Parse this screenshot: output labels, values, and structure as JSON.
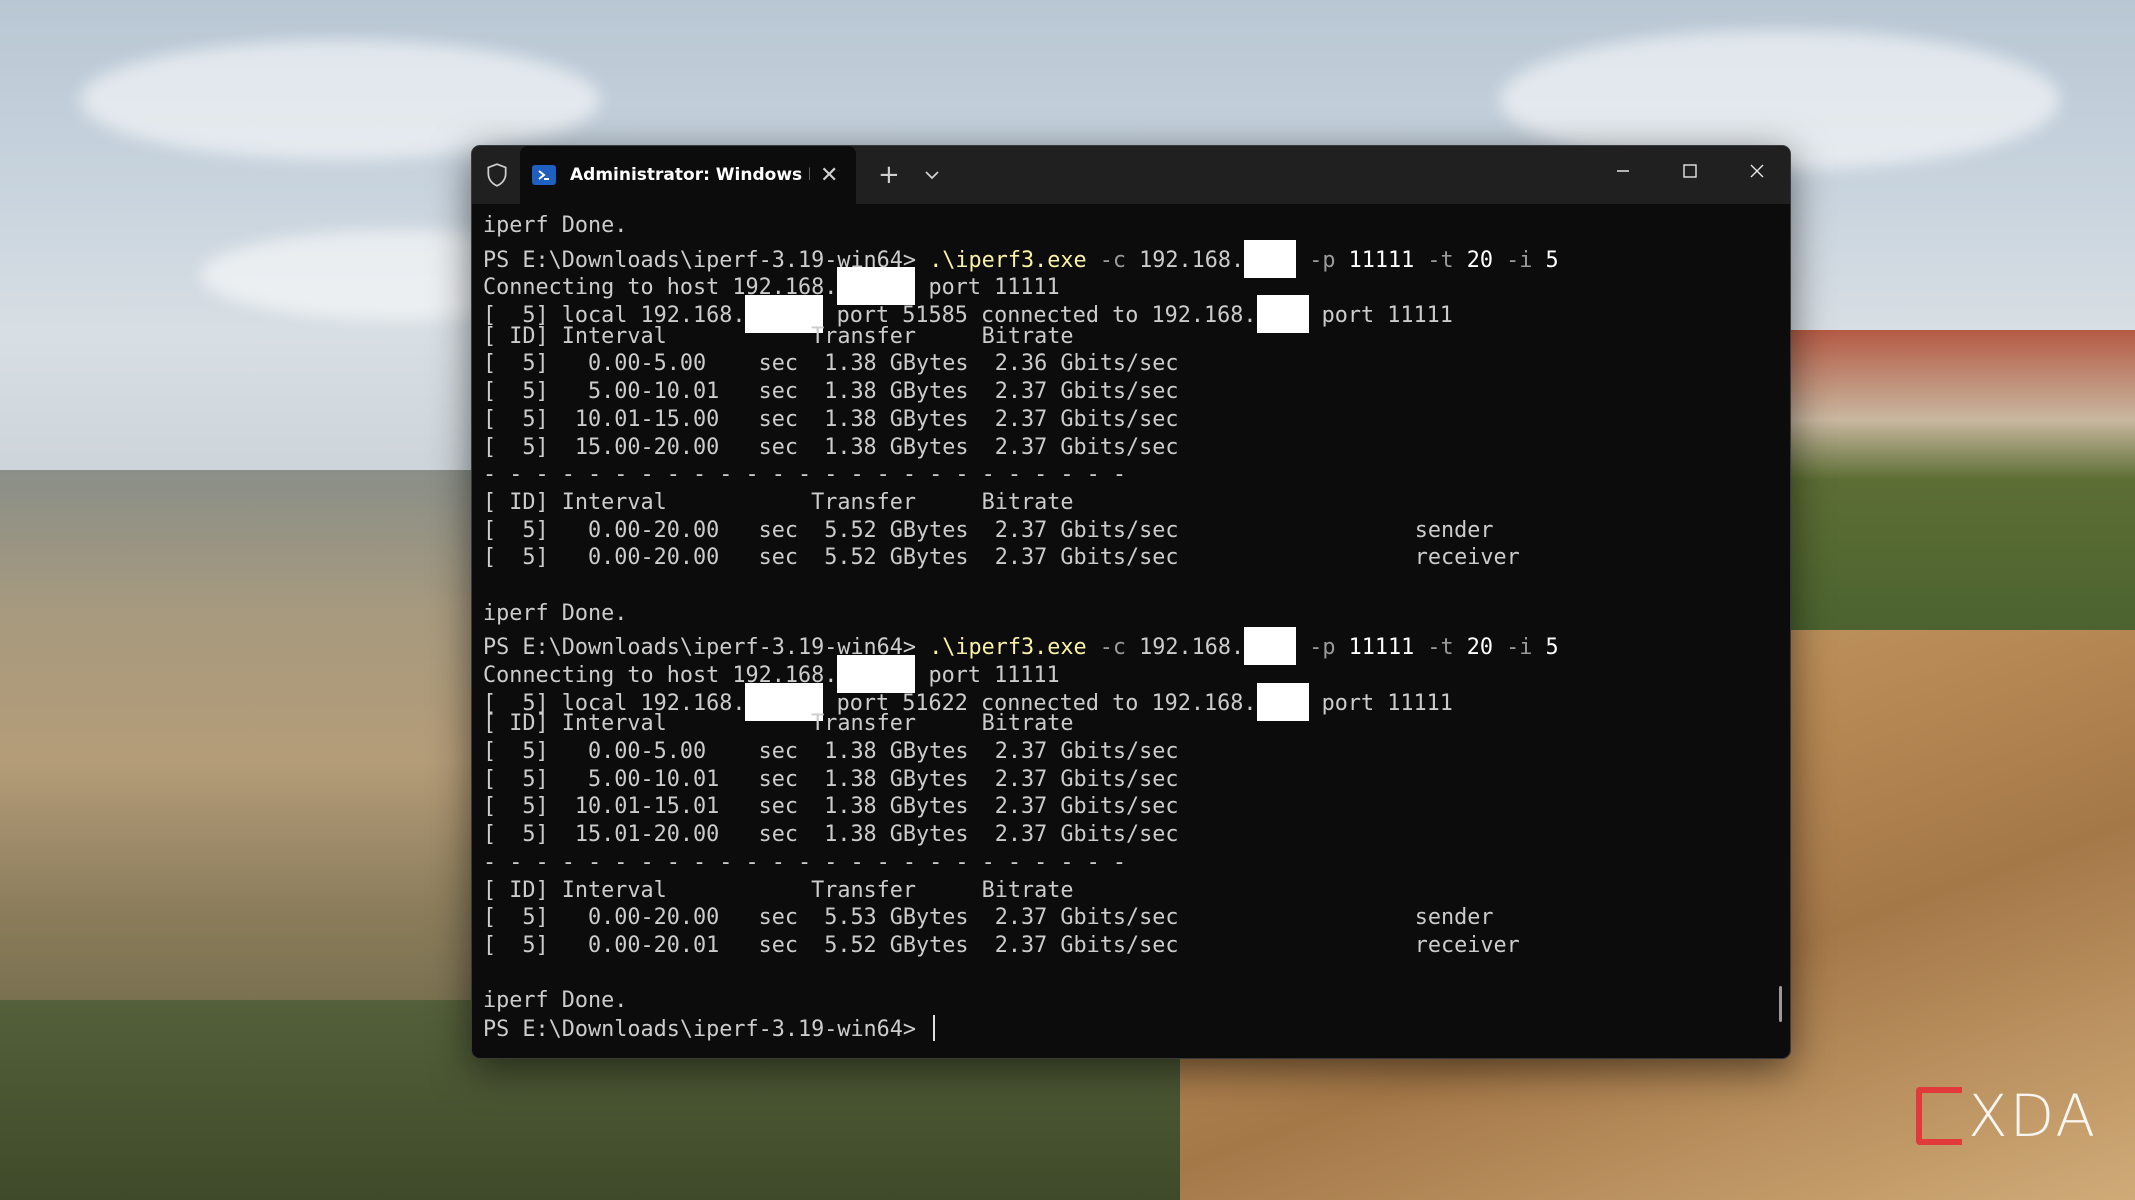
{
  "tab": {
    "title": "Administrator: Windows Powe",
    "close": "✕",
    "new_tab": "+"
  },
  "window_controls": {
    "minimize": "minimize",
    "maximize": "maximize",
    "close": "close"
  },
  "watermark": "XDA",
  "terminal": {
    "lines": [
      {
        "segs": [
          {
            "t": "iperf Done."
          }
        ]
      },
      {
        "segs": [
          {
            "t": "PS E:\\Downloads\\iperf-3.19-win64> "
          },
          {
            "t": ".\\iperf3.exe",
            "c": "y"
          },
          {
            "t": " -c ",
            "c": "g"
          },
          {
            "t": "192.168."
          },
          {
            "r": 52
          },
          {
            "t": " -p ",
            "c": "g"
          },
          {
            "t": "11111",
            "c": "w"
          },
          {
            "t": " -t ",
            "c": "g"
          },
          {
            "t": "20",
            "c": "w"
          },
          {
            "t": " -i ",
            "c": "g"
          },
          {
            "t": "5",
            "c": "w"
          }
        ]
      },
      {
        "segs": [
          {
            "t": "Connecting to host 192.168."
          },
          {
            "r": 78
          },
          {
            "t": " port 11111"
          }
        ]
      },
      {
        "segs": [
          {
            "t": "[  5] local 192.168."
          },
          {
            "r": 78
          },
          {
            "t": " port 51585 connected to 192.168."
          },
          {
            "r": 52
          },
          {
            "t": " port 11111"
          }
        ]
      },
      {
        "segs": [
          {
            "t": "[ ID] Interval           Transfer     Bitrate"
          }
        ]
      },
      {
        "segs": [
          {
            "t": "[  5]   0.00-5.00    sec  1.38 GBytes  2.36 Gbits/sec"
          }
        ]
      },
      {
        "segs": [
          {
            "t": "[  5]   5.00-10.01   sec  1.38 GBytes  2.37 Gbits/sec"
          }
        ]
      },
      {
        "segs": [
          {
            "t": "[  5]  10.01-15.00   sec  1.38 GBytes  2.37 Gbits/sec"
          }
        ]
      },
      {
        "segs": [
          {
            "t": "[  5]  15.00-20.00   sec  1.38 GBytes  2.37 Gbits/sec"
          }
        ]
      },
      {
        "segs": [
          {
            "t": "- - - - - - - - - - - - - - - - - - - - - - - - -"
          }
        ]
      },
      {
        "segs": [
          {
            "t": "[ ID] Interval           Transfer     Bitrate"
          }
        ]
      },
      {
        "segs": [
          {
            "t": "[  5]   0.00-20.00   sec  5.52 GBytes  2.37 Gbits/sec                  sender"
          }
        ]
      },
      {
        "segs": [
          {
            "t": "[  5]   0.00-20.00   sec  5.52 GBytes  2.37 Gbits/sec                  receiver"
          }
        ]
      },
      {
        "segs": [
          {
            "t": ""
          }
        ]
      },
      {
        "segs": [
          {
            "t": "iperf Done."
          }
        ]
      },
      {
        "segs": [
          {
            "t": "PS E:\\Downloads\\iperf-3.19-win64> "
          },
          {
            "t": ".\\iperf3.exe",
            "c": "y"
          },
          {
            "t": " -c ",
            "c": "g"
          },
          {
            "t": "192.168."
          },
          {
            "r": 52
          },
          {
            "t": " -p ",
            "c": "g"
          },
          {
            "t": "11111",
            "c": "w"
          },
          {
            "t": " -t ",
            "c": "g"
          },
          {
            "t": "20",
            "c": "w"
          },
          {
            "t": " -i ",
            "c": "g"
          },
          {
            "t": "5",
            "c": "w"
          }
        ]
      },
      {
        "segs": [
          {
            "t": "Connecting to host 192.168."
          },
          {
            "r": 78
          },
          {
            "t": " port 11111"
          }
        ]
      },
      {
        "segs": [
          {
            "t": "[  5] local 192.168."
          },
          {
            "r": 78
          },
          {
            "t": " port 51622 connected to 192.168."
          },
          {
            "r": 52
          },
          {
            "t": " port 11111"
          }
        ]
      },
      {
        "segs": [
          {
            "t": "[ ID] Interval           Transfer     Bitrate"
          }
        ]
      },
      {
        "segs": [
          {
            "t": "[  5]   0.00-5.00    sec  1.38 GBytes  2.37 Gbits/sec"
          }
        ]
      },
      {
        "segs": [
          {
            "t": "[  5]   5.00-10.01   sec  1.38 GBytes  2.37 Gbits/sec"
          }
        ]
      },
      {
        "segs": [
          {
            "t": "[  5]  10.01-15.01   sec  1.38 GBytes  2.37 Gbits/sec"
          }
        ]
      },
      {
        "segs": [
          {
            "t": "[  5]  15.01-20.00   sec  1.38 GBytes  2.37 Gbits/sec"
          }
        ]
      },
      {
        "segs": [
          {
            "t": "- - - - - - - - - - - - - - - - - - - - - - - - -"
          }
        ]
      },
      {
        "segs": [
          {
            "t": "[ ID] Interval           Transfer     Bitrate"
          }
        ]
      },
      {
        "segs": [
          {
            "t": "[  5]   0.00-20.00   sec  5.53 GBytes  2.37 Gbits/sec                  sender"
          }
        ]
      },
      {
        "segs": [
          {
            "t": "[  5]   0.00-20.01   sec  5.52 GBytes  2.37 Gbits/sec                  receiver"
          }
        ]
      },
      {
        "segs": [
          {
            "t": ""
          }
        ]
      },
      {
        "segs": [
          {
            "t": "iperf Done."
          }
        ]
      },
      {
        "segs": [
          {
            "t": "PS E:\\Downloads\\iperf-3.19-win64> "
          }
        ],
        "cursor": true
      }
    ]
  }
}
